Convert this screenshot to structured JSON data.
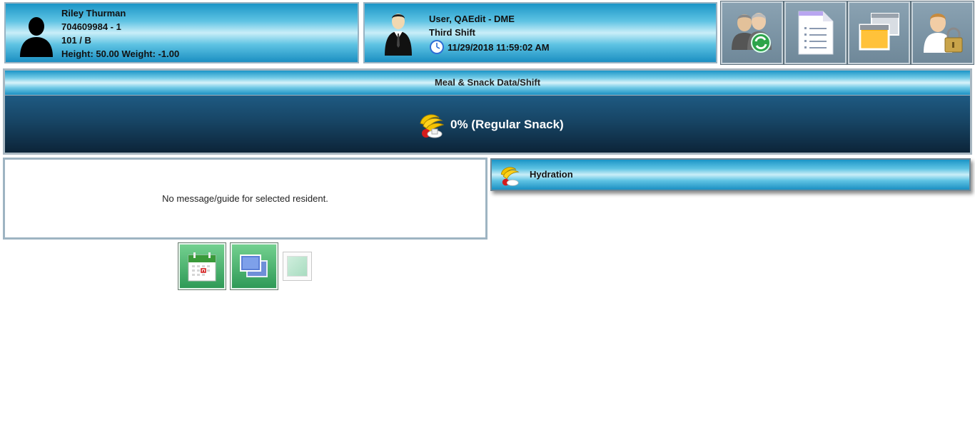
{
  "resident": {
    "name": "Riley Thurman",
    "id": "704609984 - 1",
    "room": "101 / B",
    "measurements": "Height: 50.00 Weight: -1.00"
  },
  "user": {
    "name": "User, QAEdit - DME",
    "shift": "Third Shift",
    "datetime": "11/29/2018 11:59:02 AM"
  },
  "toolbar": {
    "icons": [
      "switch-resident-icon",
      "document-list-icon",
      "windows-icon",
      "user-lock-icon"
    ]
  },
  "meal_section": {
    "title": "Meal & Snack Data/Shift",
    "status": "0% (Regular Snack)"
  },
  "message": {
    "text": "No message/guide for selected resident."
  },
  "hydration": {
    "label": "Hydration"
  },
  "colors": {
    "header_blue": "#1b95c7",
    "dark_band": "#174565",
    "tile_gray": "#7f97a7",
    "green_button": "#3aa862"
  }
}
